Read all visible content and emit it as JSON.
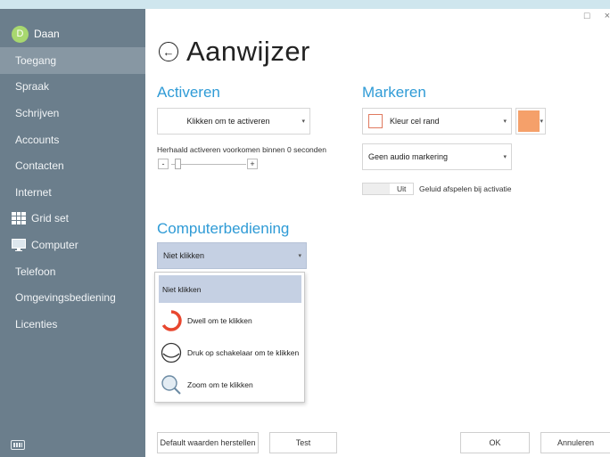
{
  "user": {
    "initial": "D",
    "name": "Daan"
  },
  "nav": [
    {
      "label": "Toegang",
      "active": true
    },
    {
      "label": "Spraak"
    },
    {
      "label": "Schrijven"
    },
    {
      "label": "Accounts"
    },
    {
      "label": "Contacten"
    },
    {
      "label": "Internet"
    },
    {
      "label": "Grid set",
      "icon": "grid-icon"
    },
    {
      "label": "Computer",
      "icon": "monitor-icon"
    },
    {
      "label": "Telefoon"
    },
    {
      "label": "Omgevingsbediening"
    },
    {
      "label": "Licenties"
    }
  ],
  "window_controls": {
    "maximize": "□",
    "close": "×"
  },
  "page": {
    "title": "Aanwijzer"
  },
  "activeren": {
    "heading": "Activeren",
    "dropdown_value": "Klikken om te activeren",
    "repeat_label": "Herhaald activeren voorkomen binnen 0 seconden",
    "minus": "-",
    "plus": "+"
  },
  "markeren": {
    "heading": "Markeren",
    "color_option": "Kleur cel rand",
    "swatch_color": "#f5a06a",
    "audio_value": "Geen audio markering",
    "toggle_state": "Uit",
    "sound_label": "Geluid afspelen bij activatie"
  },
  "computerbediening": {
    "heading": "Computerbediening",
    "dropdown_value": "Niet klikken",
    "options": [
      {
        "label": "Niet klikken",
        "selected": true
      },
      {
        "label": "Dwell om te klikken",
        "icon": "dwell-icon"
      },
      {
        "label": "Druk op schakelaar om te klikken",
        "icon": "switch-icon"
      },
      {
        "label": "Zoom om te klikken",
        "icon": "zoom-icon"
      }
    ]
  },
  "footer": {
    "reset": "Default waarden herstellen",
    "test": "Test",
    "ok": "OK",
    "cancel": "Annuleren"
  },
  "colors": {
    "sidebar": "#6b7e8c",
    "accent": "#2f9bd6",
    "selected": "#c5d0e3",
    "dwell": "#e8472f"
  }
}
